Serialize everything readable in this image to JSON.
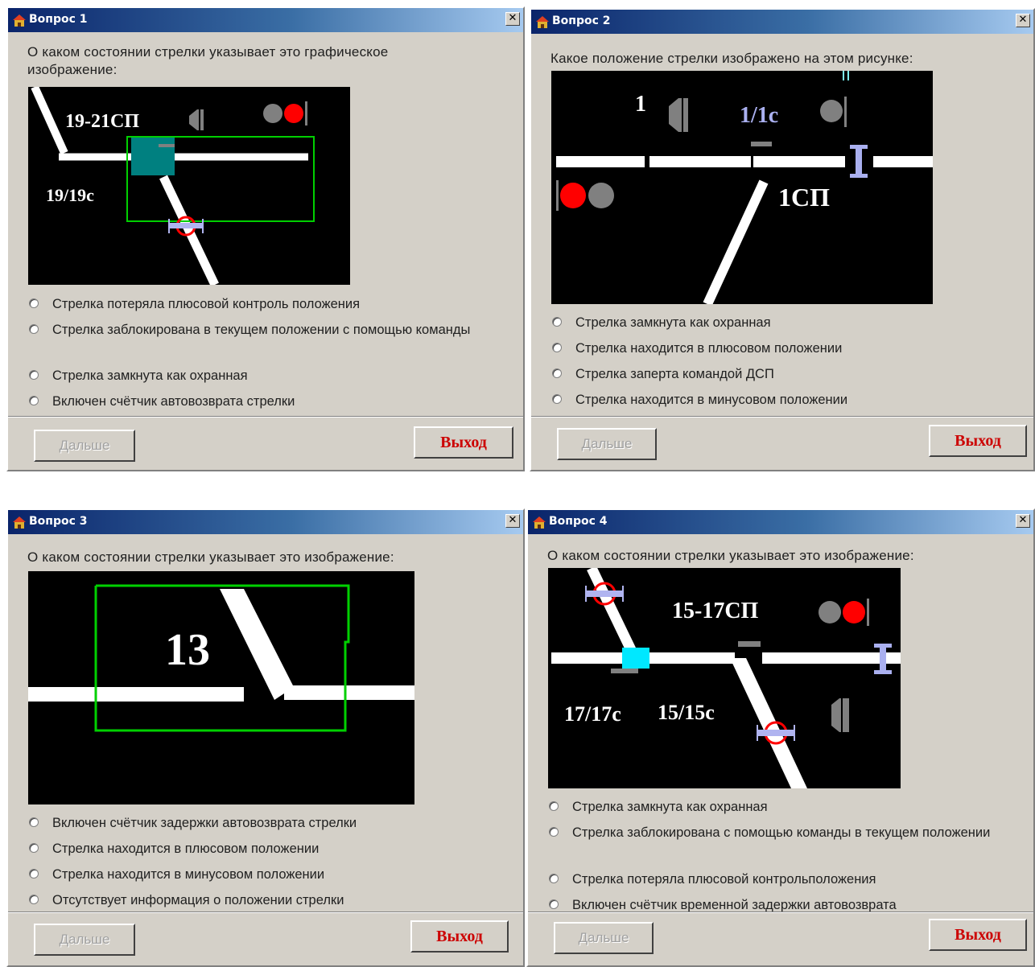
{
  "exit_label": "Выход",
  "next_label": "Дальше",
  "colors": {
    "title_start": "#0a246a",
    "title_end": "#a6caf0",
    "exit_text": "#cc0000",
    "window_bg": "#d4d0c8"
  },
  "icons": {
    "app": "house-icon",
    "close": "close-icon",
    "radio": "radio-button"
  },
  "q1": {
    "title": "Вопрос  1",
    "question": "О каком  состоянии  стрелки указывает это графическое изображение:",
    "labels": {
      "section": "19-21СП",
      "switch": "19/19с"
    },
    "options": [
      "Стрелка потеряла плюсовой контроль  положения",
      "Стрелка заблокирована в текущем положении с помощью команды",
      "Стрелка замкнута как охранная",
      "Включен счётчик автовозврата стрелки"
    ]
  },
  "q2": {
    "title": "Вопрос  2",
    "question": "Какое положение стрелки изображено на этом рисунке:",
    "labels": {
      "signal": "1",
      "switch": "1/1с",
      "section": "1СП"
    },
    "options": [
      "Стрелка замкнута как охранная",
      "Стрелка находится в плюсовом положении",
      "Стрелка заперта командой ДСП",
      "Стрелка находится в минусовом положении"
    ]
  },
  "q3": {
    "title": "Вопрос  3",
    "question": "О каком состоянии стрелки  указывает это изображение:",
    "labels": {
      "switch": "13"
    },
    "options": [
      "Включен счётчик задержки автовозврата стрелки",
      "Стрелка находится в плюсовом положении",
      "Стрелка находится в минусовом положении",
      "Отсутствует информация о положении стрелки"
    ]
  },
  "q4": {
    "title": "Вопрос  4",
    "question": "О каком состоянии стрелки указывает это изображение:",
    "labels": {
      "section": "15-17СП",
      "switch_a": "17/17с",
      "switch_b": "15/15с"
    },
    "options": [
      "Стрелка замкнута как охранная",
      "Стрелка заблокирована с помощью команды в текущем положении",
      "Стрелка потеряла плюсовой контрольположения",
      "Включен счётчик временной задержки автовозврата"
    ]
  }
}
